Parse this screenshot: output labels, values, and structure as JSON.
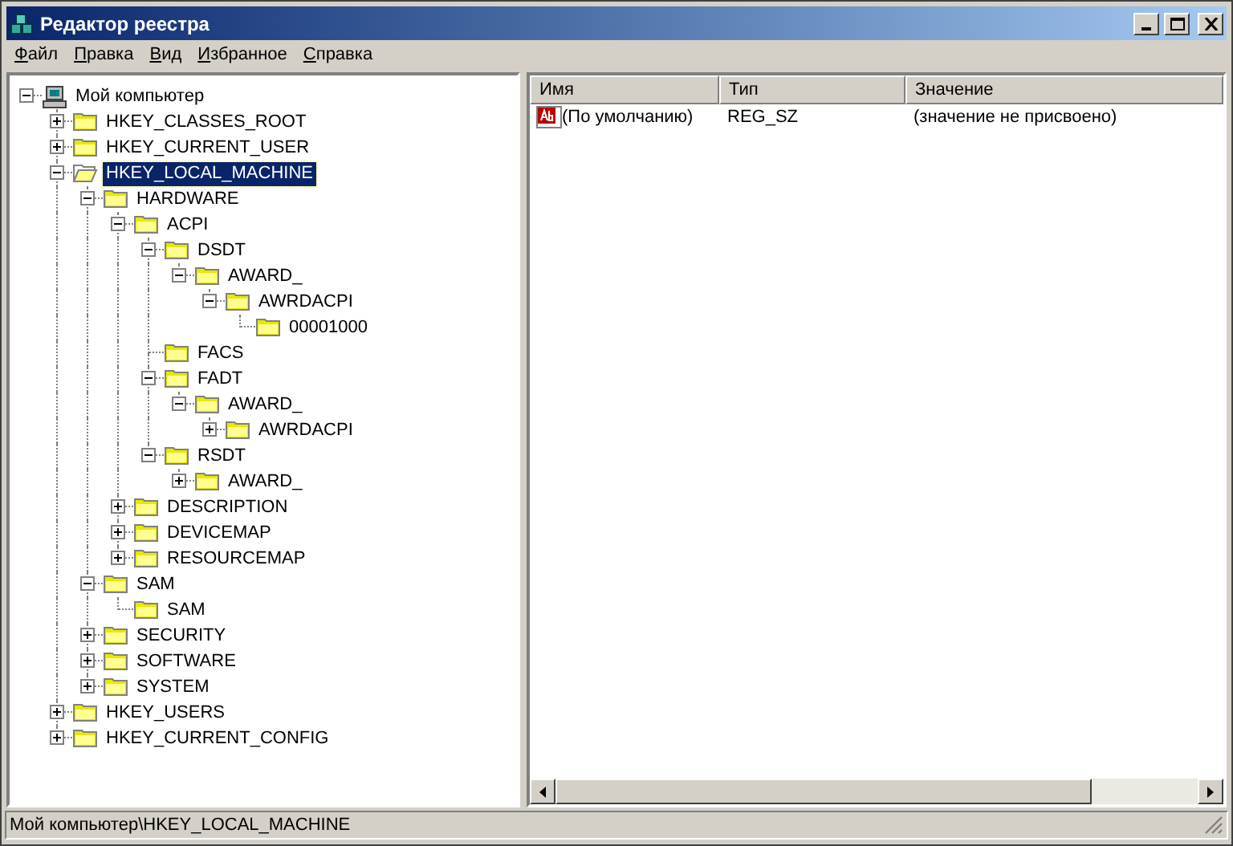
{
  "window": {
    "title": "Редактор реестра"
  },
  "menu": [
    "Файл",
    "Правка",
    "Вид",
    "Избранное",
    "Справка"
  ],
  "tree": [
    {
      "label": "Мой компьютер",
      "kind": "computer",
      "expanded": true,
      "selected": false,
      "children": [
        {
          "label": "HKEY_CLASSES_ROOT",
          "kind": "folder",
          "expanded": false,
          "selected": false
        },
        {
          "label": "HKEY_CURRENT_USER",
          "kind": "folder",
          "expanded": false,
          "selected": false
        },
        {
          "label": "HKEY_LOCAL_MACHINE",
          "kind": "folder",
          "expanded": true,
          "selected": true,
          "children": [
            {
              "label": "HARDWARE",
              "kind": "folder",
              "expanded": true,
              "selected": false,
              "children": [
                {
                  "label": "ACPI",
                  "kind": "folder",
                  "expanded": true,
                  "selected": false,
                  "children": [
                    {
                      "label": "DSDT",
                      "kind": "folder",
                      "expanded": true,
                      "selected": false,
                      "children": [
                        {
                          "label": "AWARD_",
                          "kind": "folder",
                          "expanded": true,
                          "selected": false,
                          "children": [
                            {
                              "label": "AWRDACPI",
                              "kind": "folder",
                              "expanded": true,
                              "selected": false,
                              "children": [
                                {
                                  "label": "00001000",
                                  "kind": "folder",
                                  "selected": false
                                }
                              ]
                            }
                          ]
                        }
                      ]
                    },
                    {
                      "label": "FACS",
                      "kind": "folder",
                      "selected": false
                    },
                    {
                      "label": "FADT",
                      "kind": "folder",
                      "expanded": true,
                      "selected": false,
                      "children": [
                        {
                          "label": "AWARD_",
                          "kind": "folder",
                          "expanded": true,
                          "selected": false,
                          "children": [
                            {
                              "label": "AWRDACPI",
                              "kind": "folder",
                              "expanded": false,
                              "selected": false
                            }
                          ]
                        }
                      ]
                    },
                    {
                      "label": "RSDT",
                      "kind": "folder",
                      "expanded": true,
                      "selected": false,
                      "children": [
                        {
                          "label": "AWARD_",
                          "kind": "folder",
                          "expanded": false,
                          "selected": false
                        }
                      ]
                    }
                  ]
                },
                {
                  "label": "DESCRIPTION",
                  "kind": "folder",
                  "expanded": false,
                  "selected": false
                },
                {
                  "label": "DEVICEMAP",
                  "kind": "folder",
                  "expanded": false,
                  "selected": false
                },
                {
                  "label": "RESOURCEMAP",
                  "kind": "folder",
                  "expanded": false,
                  "selected": false
                }
              ]
            },
            {
              "label": "SAM",
              "kind": "folder",
              "expanded": true,
              "selected": false,
              "children": [
                {
                  "label": "SAM",
                  "kind": "folder",
                  "selected": false
                }
              ]
            },
            {
              "label": "SECURITY",
              "kind": "folder",
              "expanded": false,
              "selected": false
            },
            {
              "label": "SOFTWARE",
              "kind": "folder",
              "expanded": false,
              "selected": false
            },
            {
              "label": "SYSTEM",
              "kind": "folder",
              "expanded": false,
              "selected": false
            }
          ]
        },
        {
          "label": "HKEY_USERS",
          "kind": "folder",
          "expanded": false,
          "selected": false
        },
        {
          "label": "HKEY_CURRENT_CONFIG",
          "kind": "folder",
          "expanded": false,
          "selected": false
        }
      ]
    }
  ],
  "table": {
    "columns": [
      "Имя",
      "Тип",
      "Значение"
    ],
    "rows": [
      {
        "kind": "string",
        "cells": [
          "(По умолчанию)",
          "REG_SZ",
          "(значение не присвоено)"
        ]
      }
    ]
  },
  "status_bar": "Мой компьютер\\HKEY_LOCAL_MACHINE"
}
